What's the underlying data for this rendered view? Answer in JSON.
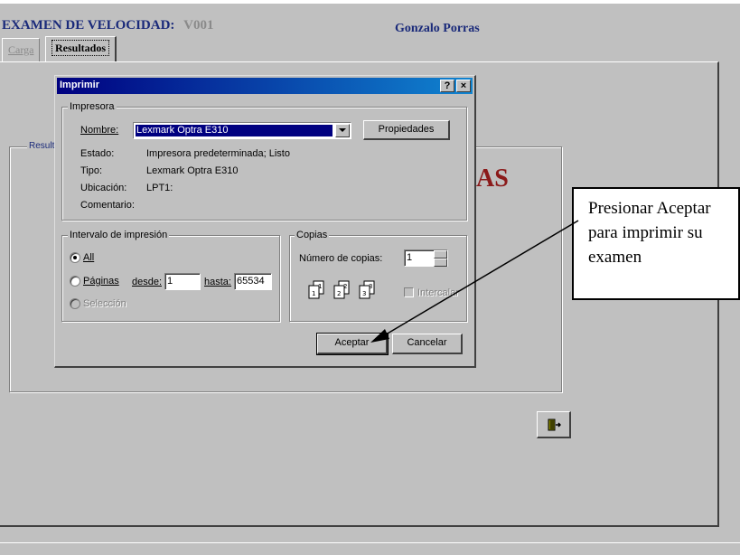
{
  "app": {
    "title_label": "EXAMEN DE VELOCIDAD:",
    "code": "V001",
    "user_name": "Gonzalo Porras",
    "tabs": [
      {
        "label": "Carga",
        "active": false
      },
      {
        "label": "Resultados",
        "active": true
      }
    ],
    "results_group_label": "Result",
    "big_text_fragment": "AS",
    "exit_icon": "exit-door-icon"
  },
  "dialog": {
    "title": "Imprimir",
    "help_button": "?",
    "close_button": "×",
    "printer_group": {
      "label": "Impresora",
      "name_label": "Nombre:",
      "name_value": "Lexmark Optra E310",
      "properties_button": "Propiedades",
      "status_label": "Estado:",
      "status_value": "Impresora predeterminada; Listo",
      "type_label": "Tipo:",
      "type_value": "Lexmark Optra E310",
      "location_label": "Ubicación:",
      "location_value": "LPT1:",
      "comment_label": "Comentario:",
      "comment_value": ""
    },
    "range_group": {
      "label": "Intervalo de impresión",
      "all_label": "All",
      "pages_label": "Páginas",
      "from_label": "desde:",
      "from_value": "1",
      "to_label": "hasta:",
      "to_value": "65534",
      "selection_label": "Selección",
      "selected": "all"
    },
    "copies_group": {
      "label": "Copias",
      "copies_label": "Número de copias:",
      "copies_value": "1",
      "collate_label": "Intercalar",
      "collate_checked": false,
      "collate_icon_pages": [
        "1",
        "1",
        "2",
        "2",
        "3",
        "3"
      ]
    },
    "ok_button": "Aceptar",
    "cancel_button": "Cancelar"
  },
  "callout": {
    "text": "Presionar Aceptar para imprimir su examen"
  },
  "colors": {
    "window_bg": "#c0c0c0",
    "title_blue": "#1a2a7a",
    "title_bar": "#000080",
    "big_text_red": "#8b1a1a"
  }
}
